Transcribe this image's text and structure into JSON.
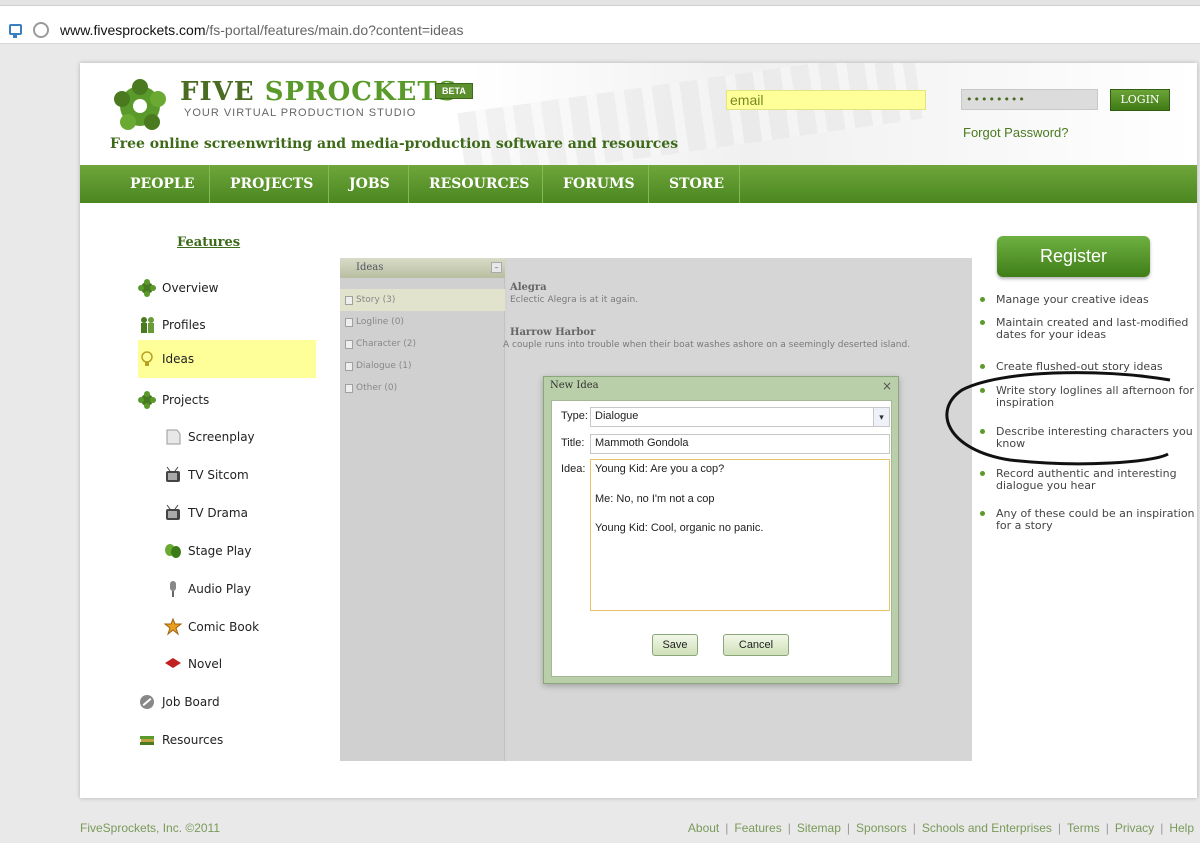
{
  "browser": {
    "url_domain": "www.fivesprockets.com",
    "url_path": "/fs-portal/features/main.do?content=ideas"
  },
  "header": {
    "logo_five": "FIVE",
    "logo_sprockets": "SPROCKETS",
    "beta": "BETA",
    "logo_sub": "YOUR VIRTUAL PRODUCTION STUDIO",
    "tagline": "Free online screenwriting and media-production software and resources",
    "email_value": "email",
    "password_value": "••••••••",
    "login_label": "LOGIN",
    "forgot_label": "Forgot Password?"
  },
  "nav": [
    "PEOPLE",
    "PROJECTS",
    "JOBS",
    "RESOURCES",
    "FORUMS",
    "STORE"
  ],
  "sidebar": {
    "title": "Features",
    "items": [
      {
        "label": "Overview",
        "icon": "sprocket-icon"
      },
      {
        "label": "Profiles",
        "icon": "people-icon"
      },
      {
        "label": "Ideas",
        "icon": "lightbulb-icon"
      },
      {
        "label": "Projects",
        "icon": "sprocket-icon"
      },
      {
        "label": "Screenplay",
        "icon": "paper-icon"
      },
      {
        "label": "TV Sitcom",
        "icon": "tv-icon"
      },
      {
        "label": "TV Drama",
        "icon": "tv-icon"
      },
      {
        "label": "Stage Play",
        "icon": "masks-icon"
      },
      {
        "label": "Audio Play",
        "icon": "microphone-icon"
      },
      {
        "label": "Comic Book",
        "icon": "comic-icon"
      },
      {
        "label": "Novel",
        "icon": "book-icon"
      },
      {
        "label": "Job Board",
        "icon": "wrench-icon"
      },
      {
        "label": "Resources",
        "icon": "books-icon"
      }
    ]
  },
  "ideas_panel": {
    "header": "Ideas",
    "categories": [
      {
        "label": "Story (3)"
      },
      {
        "label": "Logline (0)"
      },
      {
        "label": "Character (2)"
      },
      {
        "label": "Dialogue (1)"
      },
      {
        "label": "Other (0)"
      }
    ],
    "ideas": [
      {
        "title": "Alegra",
        "desc": "Eclectic Alegra is at it again."
      },
      {
        "title": "Harrow Harbor",
        "desc": "A couple runs into trouble when their boat washes ashore on a seemingly deserted island."
      }
    ]
  },
  "modal": {
    "title": "New Idea",
    "close": "×",
    "type_label": "Type:",
    "type_value": "Dialogue",
    "title_label": "Title:",
    "title_value": "Mammoth Gondola",
    "idea_label": "Idea:",
    "idea_lines": [
      "Young Kid: Are you a cop?",
      "Me: No, no I'm not a cop",
      "Young Kid: Cool, organic no panic."
    ],
    "save_label": "Save",
    "cancel_label": "Cancel"
  },
  "right": {
    "register_label": "Register",
    "bullets": [
      "Manage your creative ideas",
      "Maintain created and last-modified dates for your ideas",
      "Create flushed-out story ideas",
      "Write story loglines all afternoon for inspiration",
      "Describe interesting characters you know",
      "Record authentic and interesting dialogue you hear",
      "Any of these could be an inspiration for a story"
    ]
  },
  "footer": {
    "copyright": "FiveSprockets, Inc. ©2011",
    "links": [
      "About",
      "Features",
      "Sitemap",
      "Sponsors",
      "Schools and Enterprises",
      "Terms",
      "Privacy",
      "Help"
    ]
  },
  "colors": {
    "brand_green": "#4b8620",
    "highlight_yellow": "#ffff99"
  }
}
